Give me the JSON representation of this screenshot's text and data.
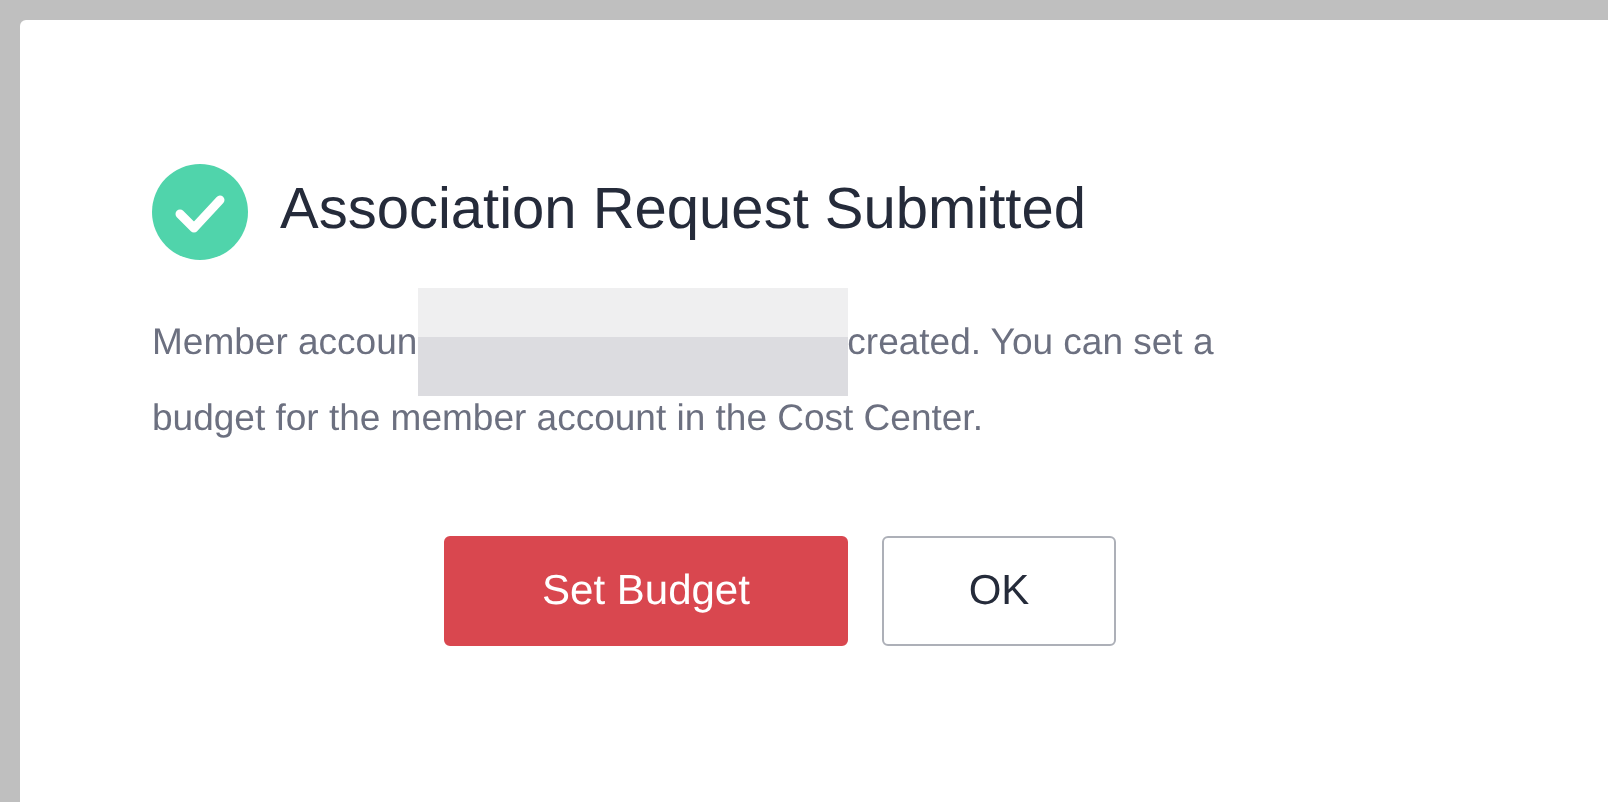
{
  "dialog": {
    "title": "Association Request Submitted",
    "message_before": "Member accoun",
    "message_after": "created. You can set a",
    "message_line_2": "budget for the member account in the Cost Center.",
    "buttons": [
      {
        "label": "Set Budget",
        "kind": "primary"
      },
      {
        "label": "OK",
        "kind": "secondary"
      }
    ]
  }
}
